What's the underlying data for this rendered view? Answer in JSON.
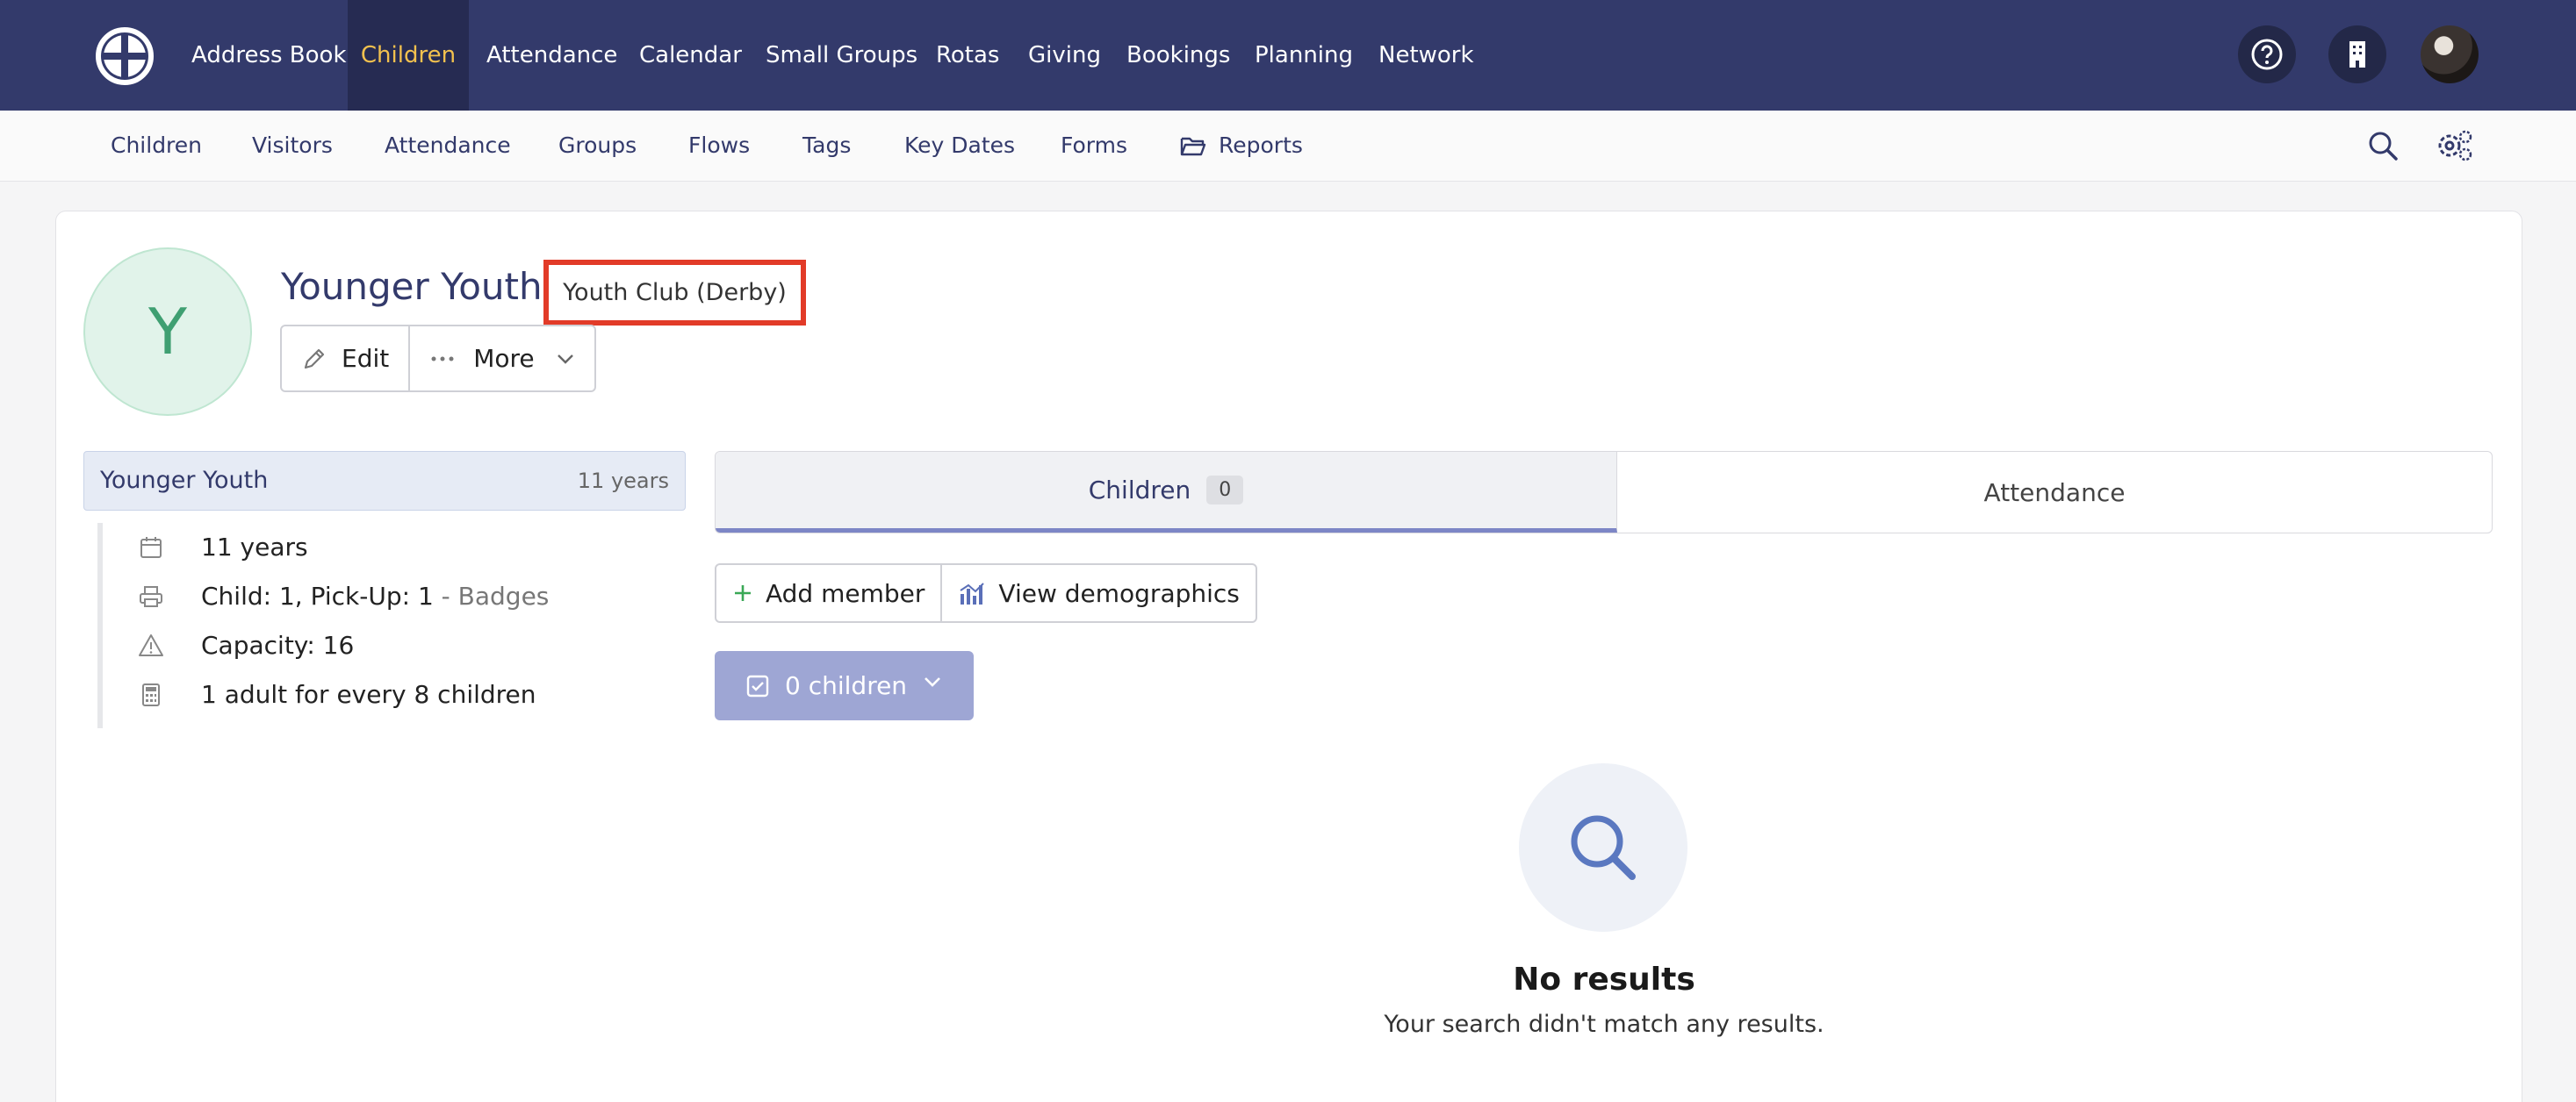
{
  "topnav": {
    "items": [
      {
        "label": "Address Book"
      },
      {
        "label": "Children",
        "active": true
      },
      {
        "label": "Attendance"
      },
      {
        "label": "Calendar"
      },
      {
        "label": "Small Groups"
      },
      {
        "label": "Rotas"
      },
      {
        "label": "Giving"
      },
      {
        "label": "Bookings"
      },
      {
        "label": "Planning"
      },
      {
        "label": "Network"
      }
    ],
    "active_color": "#f2c14e",
    "background": "#333a6b"
  },
  "subnav": {
    "items": [
      {
        "label": "Children"
      },
      {
        "label": "Visitors"
      },
      {
        "label": "Attendance"
      },
      {
        "label": "Groups"
      },
      {
        "label": "Flows"
      },
      {
        "label": "Tags"
      },
      {
        "label": "Key Dates"
      },
      {
        "label": "Forms"
      },
      {
        "label": "Reports"
      }
    ]
  },
  "group": {
    "avatar_letter": "Y",
    "title": "Younger Youth",
    "badge": "Youth Club (Derby)",
    "edit_label": "Edit",
    "more_label": "More"
  },
  "side": {
    "name": "Younger Youth",
    "age": "11 years",
    "rows": [
      {
        "icon": "calendar-icon",
        "text": "11 years"
      },
      {
        "icon": "printer-icon",
        "text": "Child: 1, Pick-Up: 1",
        "suffix": " - Badges"
      },
      {
        "icon": "warning-icon",
        "text": "Capacity: 16"
      },
      {
        "icon": "calculator-icon",
        "text": "1 adult for every 8 children"
      }
    ]
  },
  "tabs": {
    "children_label": "Children",
    "children_count": "0",
    "attendance_label": "Attendance"
  },
  "actions": {
    "add_member": "Add member",
    "view_demographics": "View demographics",
    "select_label": "0 children"
  },
  "empty": {
    "title": "No results",
    "subtitle": "Your search didn't match any results."
  }
}
